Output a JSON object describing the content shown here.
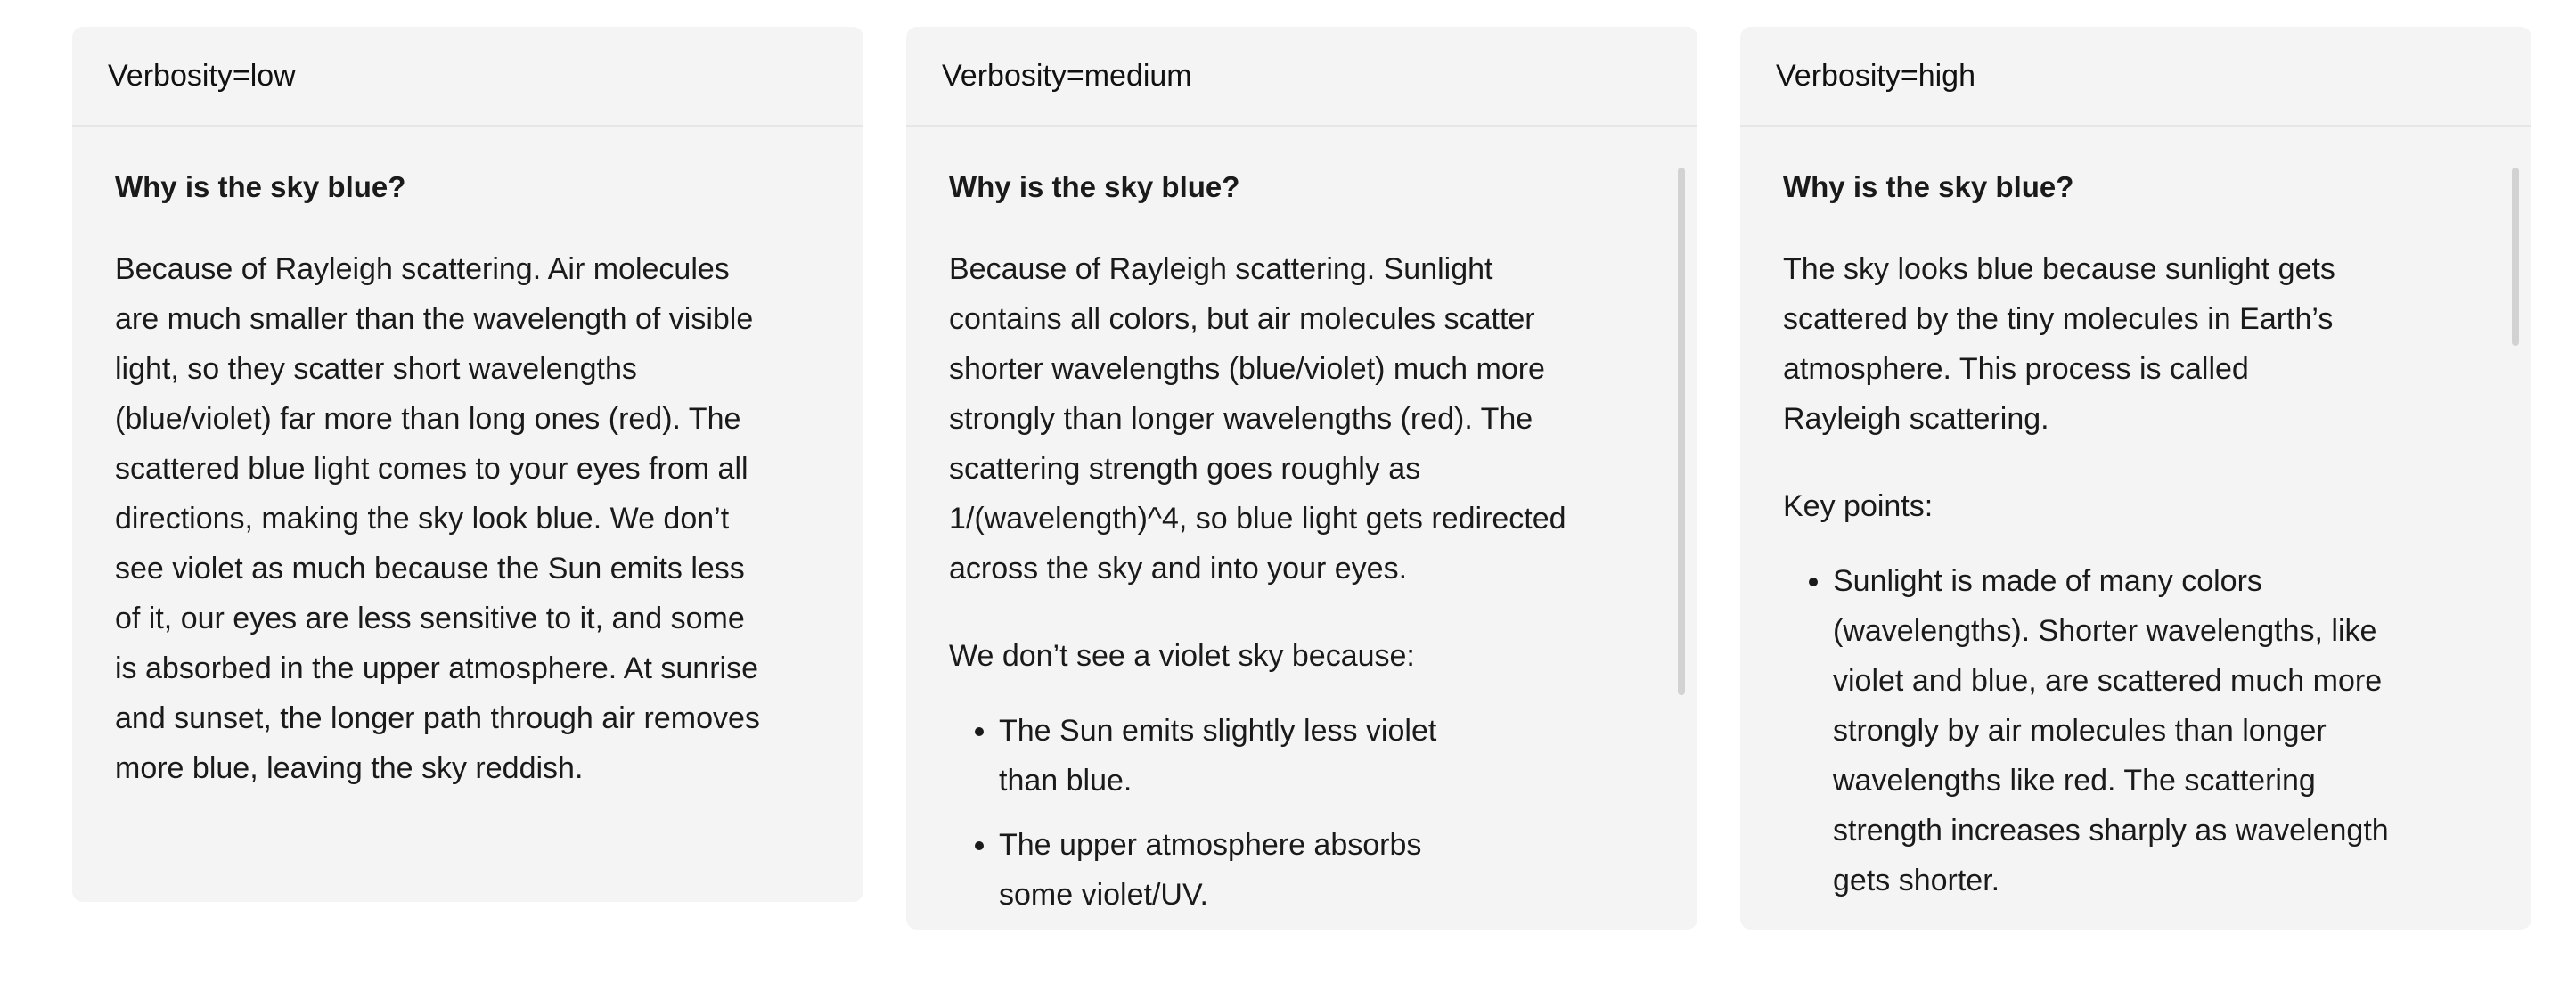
{
  "panels": {
    "low": {
      "title": "Verbosity=low",
      "question": "Why is the sky blue?",
      "paragraphs": [
        "Because of Rayleigh scattering. Air molecules are much smaller than the wavelength of visible light, so they scatter short wavelengths (blue/violet) far more than long ones (red). The scattered blue light comes to your eyes from all directions, making the sky look blue. We don’t see violet as much because the Sun emits less of it, our eyes are less sensitive to it, and some is absorbed in the upper atmosphere. At sunrise and sunset, the longer path through air removes more blue, leaving the sky reddish."
      ]
    },
    "medium": {
      "title": "Verbosity=medium",
      "question": "Why is the sky blue?",
      "paragraphs": [
        "Because of Rayleigh scattering. Sunlight contains all colors, but air molecules scatter shorter wavelengths (blue/violet) much more strongly than longer wavelengths (red). The scattering strength goes roughly as 1/(wavelength)^4, so blue light gets redirected across the sky and into your eyes.",
        "We don’t see a violet sky because:"
      ],
      "bullets": [
        "The Sun emits slightly less violet than blue.",
        "The upper atmosphere absorbs some violet/UV."
      ]
    },
    "high": {
      "title": "Verbosity=high",
      "question": "Why is the sky blue?",
      "paragraphs": [
        "The sky looks blue because sunlight gets scattered by the tiny molecules in Earth’s atmosphere. This process is called Rayleigh scattering.",
        "Key points:"
      ],
      "bullets": [
        "Sunlight is made of many colors (wavelengths). Shorter wavelengths, like violet and blue, are scattered much more strongly by air molecules than longer wavelengths like red. The scattering strength increases sharply as wavelength gets shorter."
      ]
    }
  }
}
